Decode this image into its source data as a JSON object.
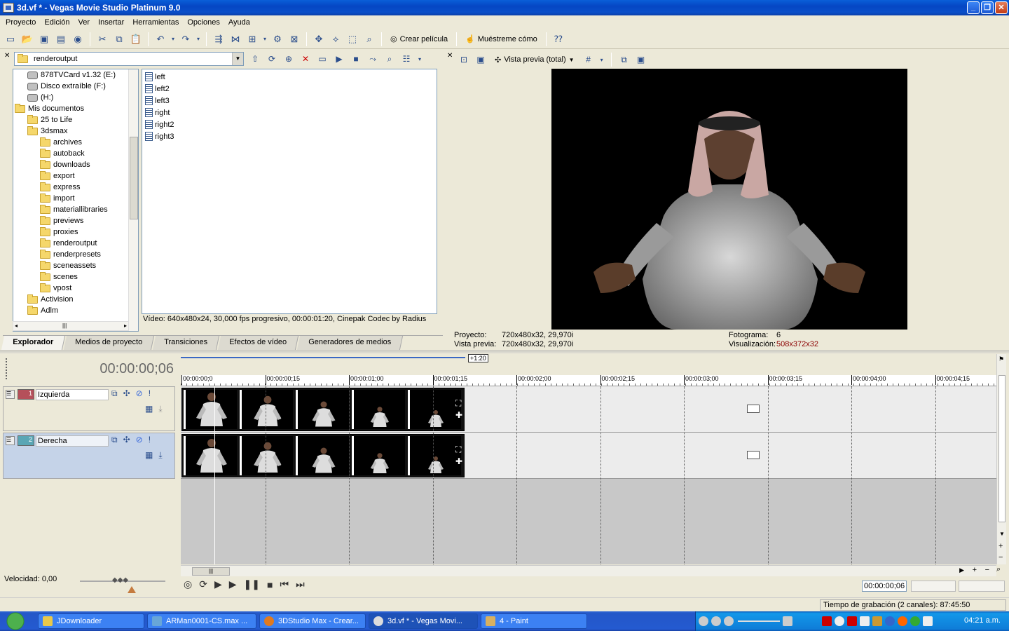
{
  "window": {
    "title": "3d.vf * - Vegas Movie Studio Platinum 9.0"
  },
  "menu": [
    "Proyecto",
    "Edición",
    "Ver",
    "Insertar",
    "Herramientas",
    "Opciones",
    "Ayuda"
  ],
  "toolbar": {
    "create_movie": "Crear película",
    "show_me": "Muéstreme cómo"
  },
  "explorer": {
    "path": "renderoutput",
    "tree": [
      {
        "label": "878TVCard v1.32 (E:)",
        "type": "drive",
        "indent": 1
      },
      {
        "label": "Disco extraíble (F:)",
        "type": "drive",
        "indent": 1
      },
      {
        "label": "(H:)",
        "type": "drive",
        "indent": 1
      },
      {
        "label": "Mis documentos",
        "type": "folder",
        "indent": 0
      },
      {
        "label": "25 to Life",
        "type": "folder",
        "indent": 1
      },
      {
        "label": "3dsmax",
        "type": "folder",
        "indent": 1
      },
      {
        "label": "archives",
        "type": "folder",
        "indent": 2
      },
      {
        "label": "autoback",
        "type": "folder",
        "indent": 2
      },
      {
        "label": "downloads",
        "type": "folder",
        "indent": 2
      },
      {
        "label": "export",
        "type": "folder",
        "indent": 2
      },
      {
        "label": "express",
        "type": "folder",
        "indent": 2
      },
      {
        "label": "import",
        "type": "folder",
        "indent": 2
      },
      {
        "label": "materiallibraries",
        "type": "folder",
        "indent": 2
      },
      {
        "label": "previews",
        "type": "folder",
        "indent": 2
      },
      {
        "label": "proxies",
        "type": "folder",
        "indent": 2
      },
      {
        "label": "renderoutput",
        "type": "folder",
        "indent": 2
      },
      {
        "label": "renderpresets",
        "type": "folder",
        "indent": 2
      },
      {
        "label": "sceneassets",
        "type": "folder",
        "indent": 2
      },
      {
        "label": "scenes",
        "type": "folder",
        "indent": 2
      },
      {
        "label": "vpost",
        "type": "folder",
        "indent": 2
      },
      {
        "label": "Activision",
        "type": "folder",
        "indent": 1
      },
      {
        "label": "Adlm",
        "type": "folder",
        "indent": 1
      }
    ],
    "files": [
      "left",
      "left2",
      "left3",
      "right",
      "right2",
      "right3"
    ],
    "media_info": "Vídeo: 640x480x24, 30,000 fps progresivo, 00:00:01:20, Cinepak Codec by Radius",
    "tabs": [
      "Explorador",
      "Medios de proyecto",
      "Transiciones",
      "Efectos de vídeo",
      "Generadores de medios"
    ]
  },
  "preview": {
    "mode": "Vista previa (total)",
    "project_label": "Proyecto:",
    "project_value": "720x480x32, 29,970i",
    "preview_label": "Vista previa:",
    "preview_value": "720x480x32, 29,970i",
    "frame_label": "Fotograma:",
    "frame_value": "6",
    "display_label": "Visualización:",
    "display_value": "508x372x32"
  },
  "timeline": {
    "timecode": "00:00:00;06",
    "loop_label": "+1:20",
    "ruler": [
      "00:00:00;0",
      "00:00:00;15",
      "00:00:01;00",
      "00:00:01;15",
      "00:00:02;00",
      "00:00:02;15",
      "00:00:03;00",
      "00:00:03;15",
      "00:00:04;00",
      "00:00:04;15"
    ],
    "tracks": [
      {
        "num": "1",
        "name": "Izquierda",
        "color": "#b5505a"
      },
      {
        "num": "2",
        "name": "Derecha",
        "color": "#5aa6b5"
      }
    ],
    "speed": "Velocidad: 0,00",
    "tc_box": "00:00:00;06"
  },
  "status": {
    "record_time": "Tiempo de grabación (2 canales): 87:45:50"
  },
  "taskbar": {
    "tasks": [
      "JDownloader",
      "ARMan0001-CS.max ...",
      "3DStudio Max - Crear...",
      "3d.vf * - Vegas Movi...",
      "4 - Paint"
    ],
    "clock": "04:21 a.m."
  }
}
